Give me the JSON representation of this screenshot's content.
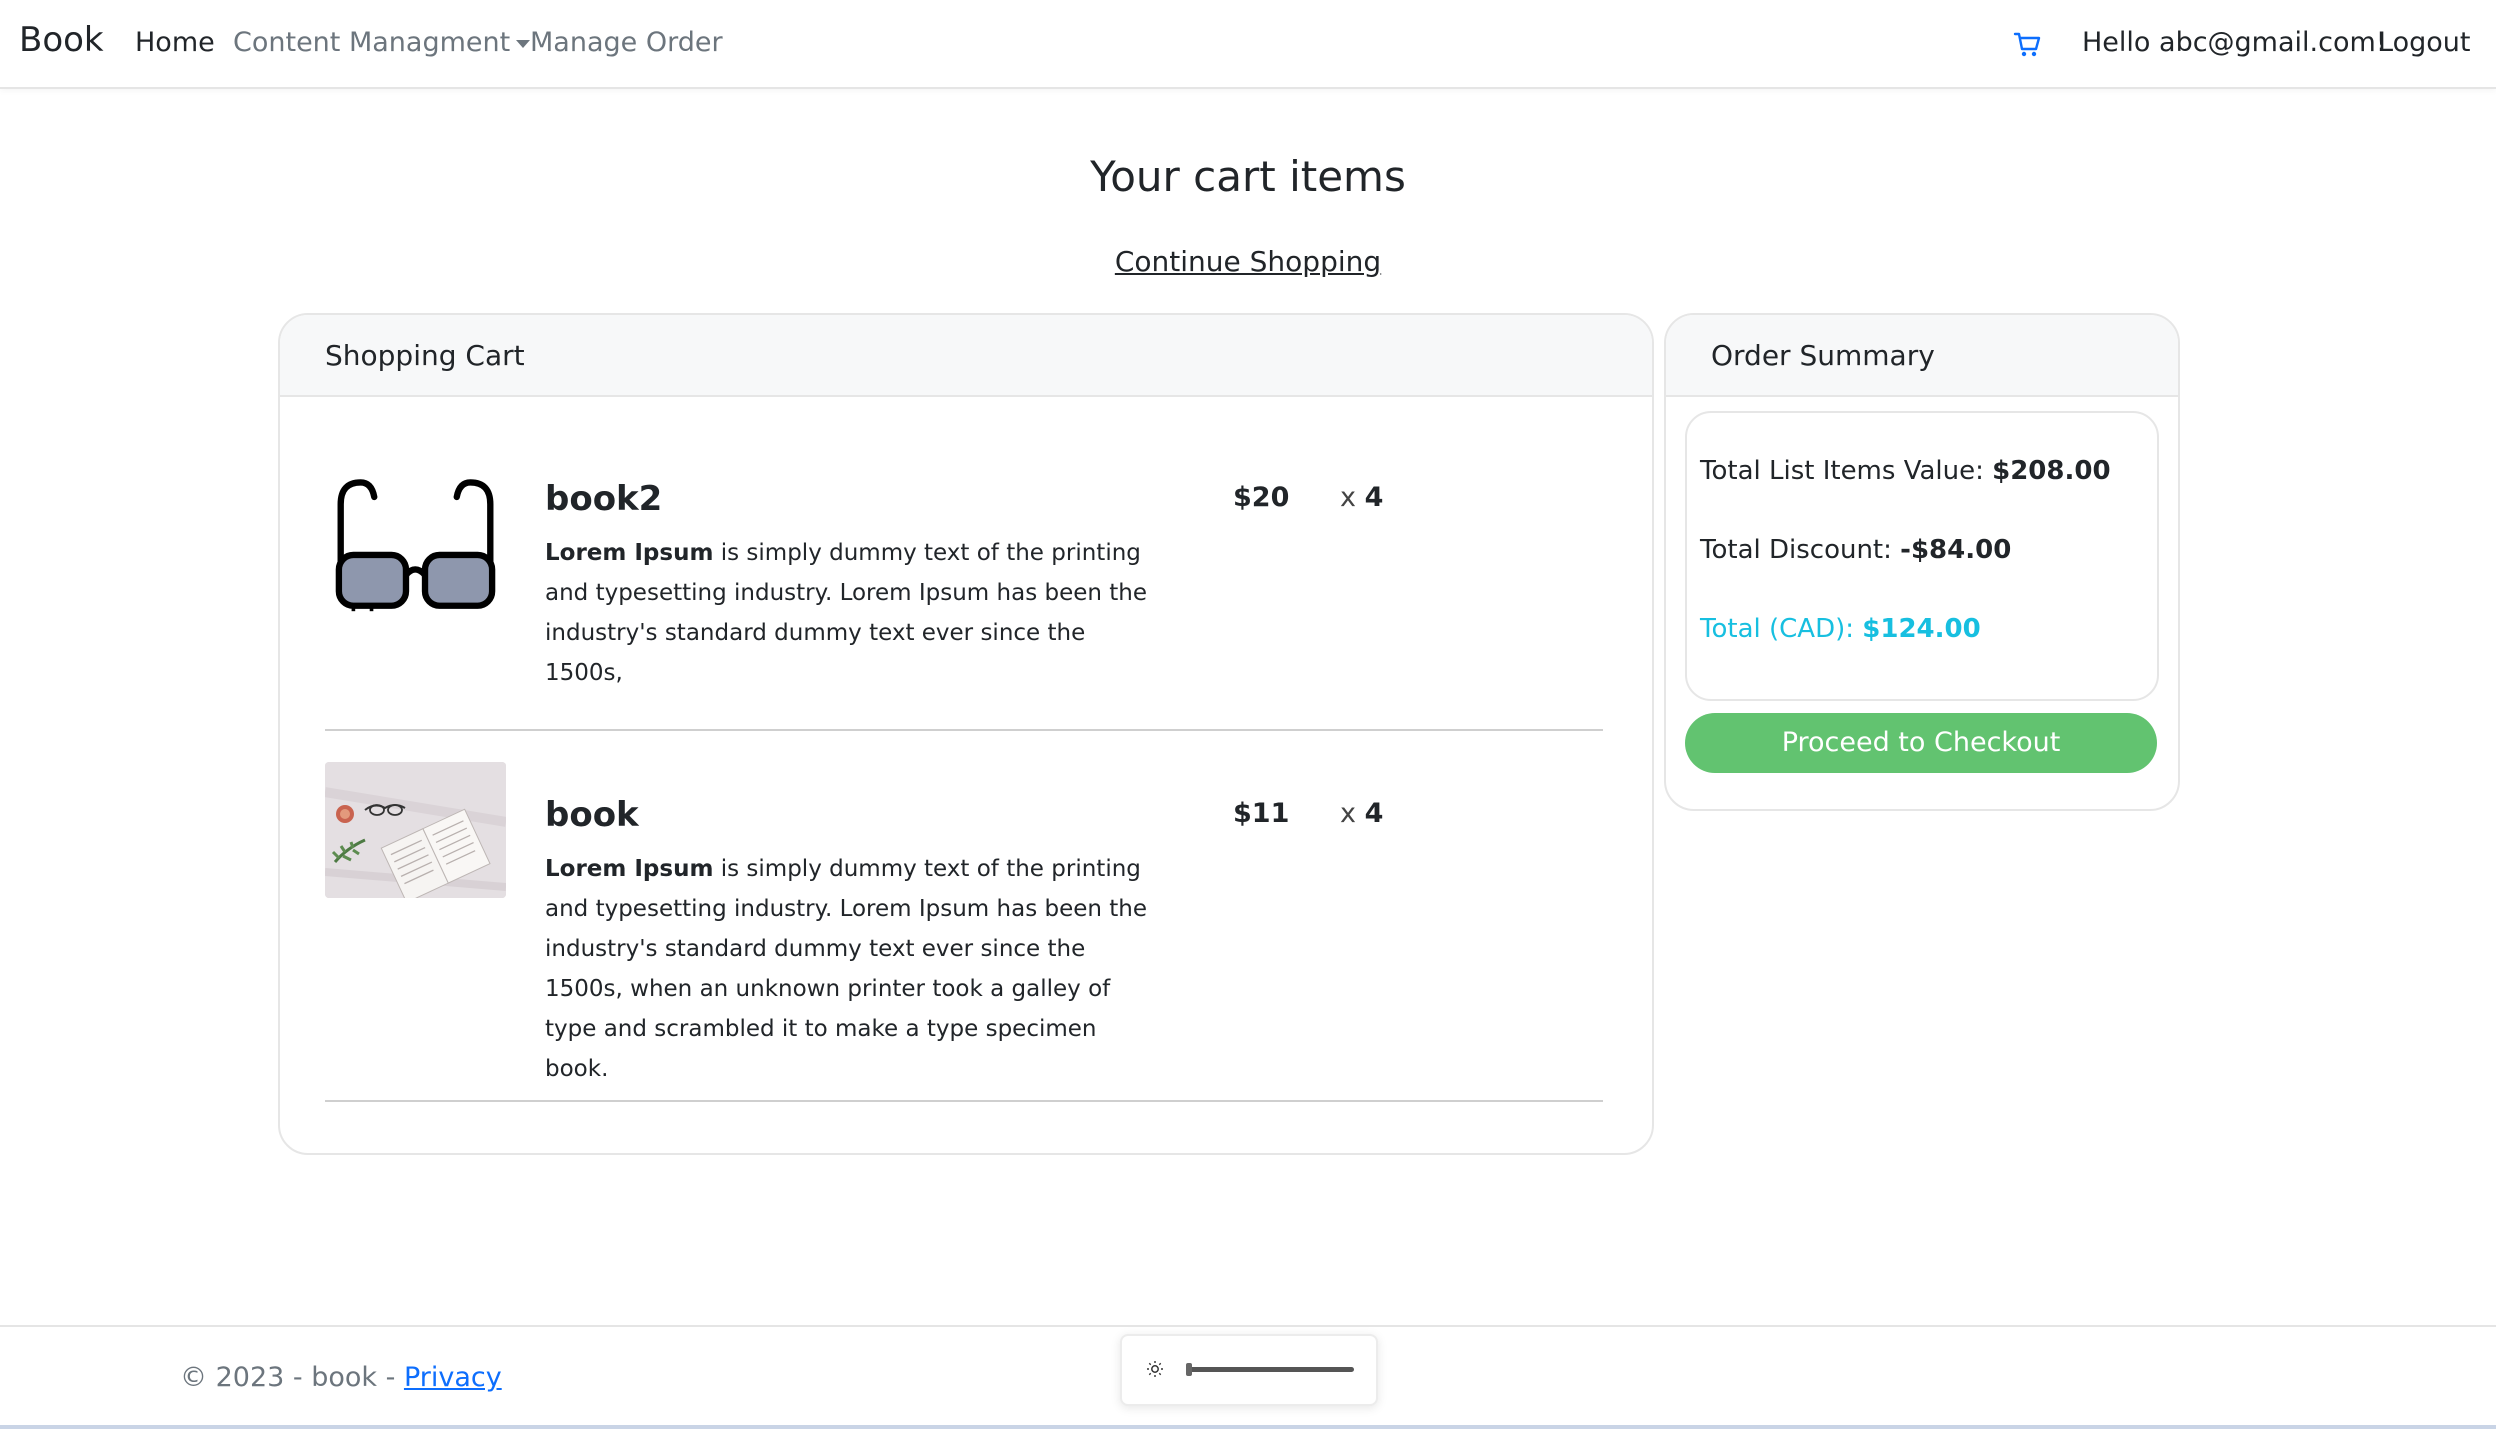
{
  "nav": {
    "brand": "Book",
    "home": "Home",
    "content": "Content Managment",
    "order": "Manage Order",
    "hello": "Hello abc@gmail.com!",
    "logout": "Logout"
  },
  "page": {
    "title": "Your cart items",
    "continue": "Continue Shopping"
  },
  "cart": {
    "header": "Shopping Cart",
    "items": [
      {
        "name": "book2",
        "desc_bold": "Lorem Ipsum",
        "desc_rest": " is simply dummy text of the printing and typesetting industry. Lorem Ipsum has been the industry's standard dummy text ever since the 1500s,",
        "price": "$20",
        "x": "x",
        "qty": "4",
        "image_icon": "glasses-icon"
      },
      {
        "name": "book",
        "desc_bold": "Lorem Ipsum",
        "desc_rest": " is simply dummy text of the printing and typesetting industry. Lorem Ipsum has been the industry's standard dummy text ever since the 1500s, when an unknown printer took a galley of type and scrambled it to make a type specimen book.",
        "price": "$11",
        "x": "x",
        "qty": "4",
        "image_icon": "book-photo"
      }
    ]
  },
  "summary": {
    "header": "Order Summary",
    "list_label": "Total List Items Value: ",
    "list_value": "$208.00",
    "discount_label": "Total Discount: ",
    "discount_value": "-$84.00",
    "total_label": "Total (CAD): ",
    "total_value": "$124.00",
    "checkout": "Proceed to Checkout"
  },
  "footer": {
    "copyright": "© 2023 - book - ",
    "privacy": "Privacy"
  },
  "brightness": {
    "level": 0.02
  },
  "colors": {
    "accent_total": "#17bfe0",
    "checkout_green": "#62c370",
    "link_blue": "#0d6efd",
    "cart_icon_blue": "#0d6efd"
  }
}
